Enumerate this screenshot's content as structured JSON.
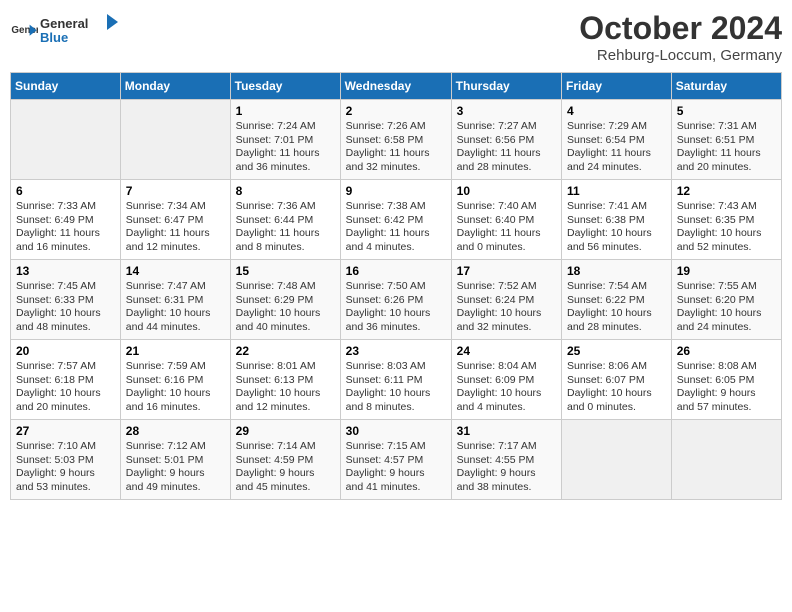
{
  "logo": {
    "text_general": "General",
    "text_blue": "Blue"
  },
  "header": {
    "month": "October 2024",
    "location": "Rehburg-Loccum, Germany"
  },
  "days_of_week": [
    "Sunday",
    "Monday",
    "Tuesday",
    "Wednesday",
    "Thursday",
    "Friday",
    "Saturday"
  ],
  "weeks": [
    [
      {
        "day": "",
        "info": ""
      },
      {
        "day": "",
        "info": ""
      },
      {
        "day": "1",
        "info": "Sunrise: 7:24 AM\nSunset: 7:01 PM\nDaylight: 11 hours\nand 36 minutes."
      },
      {
        "day": "2",
        "info": "Sunrise: 7:26 AM\nSunset: 6:58 PM\nDaylight: 11 hours\nand 32 minutes."
      },
      {
        "day": "3",
        "info": "Sunrise: 7:27 AM\nSunset: 6:56 PM\nDaylight: 11 hours\nand 28 minutes."
      },
      {
        "day": "4",
        "info": "Sunrise: 7:29 AM\nSunset: 6:54 PM\nDaylight: 11 hours\nand 24 minutes."
      },
      {
        "day": "5",
        "info": "Sunrise: 7:31 AM\nSunset: 6:51 PM\nDaylight: 11 hours\nand 20 minutes."
      }
    ],
    [
      {
        "day": "6",
        "info": "Sunrise: 7:33 AM\nSunset: 6:49 PM\nDaylight: 11 hours\nand 16 minutes."
      },
      {
        "day": "7",
        "info": "Sunrise: 7:34 AM\nSunset: 6:47 PM\nDaylight: 11 hours\nand 12 minutes."
      },
      {
        "day": "8",
        "info": "Sunrise: 7:36 AM\nSunset: 6:44 PM\nDaylight: 11 hours\nand 8 minutes."
      },
      {
        "day": "9",
        "info": "Sunrise: 7:38 AM\nSunset: 6:42 PM\nDaylight: 11 hours\nand 4 minutes."
      },
      {
        "day": "10",
        "info": "Sunrise: 7:40 AM\nSunset: 6:40 PM\nDaylight: 11 hours\nand 0 minutes."
      },
      {
        "day": "11",
        "info": "Sunrise: 7:41 AM\nSunset: 6:38 PM\nDaylight: 10 hours\nand 56 minutes."
      },
      {
        "day": "12",
        "info": "Sunrise: 7:43 AM\nSunset: 6:35 PM\nDaylight: 10 hours\nand 52 minutes."
      }
    ],
    [
      {
        "day": "13",
        "info": "Sunrise: 7:45 AM\nSunset: 6:33 PM\nDaylight: 10 hours\nand 48 minutes."
      },
      {
        "day": "14",
        "info": "Sunrise: 7:47 AM\nSunset: 6:31 PM\nDaylight: 10 hours\nand 44 minutes."
      },
      {
        "day": "15",
        "info": "Sunrise: 7:48 AM\nSunset: 6:29 PM\nDaylight: 10 hours\nand 40 minutes."
      },
      {
        "day": "16",
        "info": "Sunrise: 7:50 AM\nSunset: 6:26 PM\nDaylight: 10 hours\nand 36 minutes."
      },
      {
        "day": "17",
        "info": "Sunrise: 7:52 AM\nSunset: 6:24 PM\nDaylight: 10 hours\nand 32 minutes."
      },
      {
        "day": "18",
        "info": "Sunrise: 7:54 AM\nSunset: 6:22 PM\nDaylight: 10 hours\nand 28 minutes."
      },
      {
        "day": "19",
        "info": "Sunrise: 7:55 AM\nSunset: 6:20 PM\nDaylight: 10 hours\nand 24 minutes."
      }
    ],
    [
      {
        "day": "20",
        "info": "Sunrise: 7:57 AM\nSunset: 6:18 PM\nDaylight: 10 hours\nand 20 minutes."
      },
      {
        "day": "21",
        "info": "Sunrise: 7:59 AM\nSunset: 6:16 PM\nDaylight: 10 hours\nand 16 minutes."
      },
      {
        "day": "22",
        "info": "Sunrise: 8:01 AM\nSunset: 6:13 PM\nDaylight: 10 hours\nand 12 minutes."
      },
      {
        "day": "23",
        "info": "Sunrise: 8:03 AM\nSunset: 6:11 PM\nDaylight: 10 hours\nand 8 minutes."
      },
      {
        "day": "24",
        "info": "Sunrise: 8:04 AM\nSunset: 6:09 PM\nDaylight: 10 hours\nand 4 minutes."
      },
      {
        "day": "25",
        "info": "Sunrise: 8:06 AM\nSunset: 6:07 PM\nDaylight: 10 hours\nand 0 minutes."
      },
      {
        "day": "26",
        "info": "Sunrise: 8:08 AM\nSunset: 6:05 PM\nDaylight: 9 hours\nand 57 minutes."
      }
    ],
    [
      {
        "day": "27",
        "info": "Sunrise: 7:10 AM\nSunset: 5:03 PM\nDaylight: 9 hours\nand 53 minutes."
      },
      {
        "day": "28",
        "info": "Sunrise: 7:12 AM\nSunset: 5:01 PM\nDaylight: 9 hours\nand 49 minutes."
      },
      {
        "day": "29",
        "info": "Sunrise: 7:14 AM\nSunset: 4:59 PM\nDaylight: 9 hours\nand 45 minutes."
      },
      {
        "day": "30",
        "info": "Sunrise: 7:15 AM\nSunset: 4:57 PM\nDaylight: 9 hours\nand 41 minutes."
      },
      {
        "day": "31",
        "info": "Sunrise: 7:17 AM\nSunset: 4:55 PM\nDaylight: 9 hours\nand 38 minutes."
      },
      {
        "day": "",
        "info": ""
      },
      {
        "day": "",
        "info": ""
      }
    ]
  ]
}
